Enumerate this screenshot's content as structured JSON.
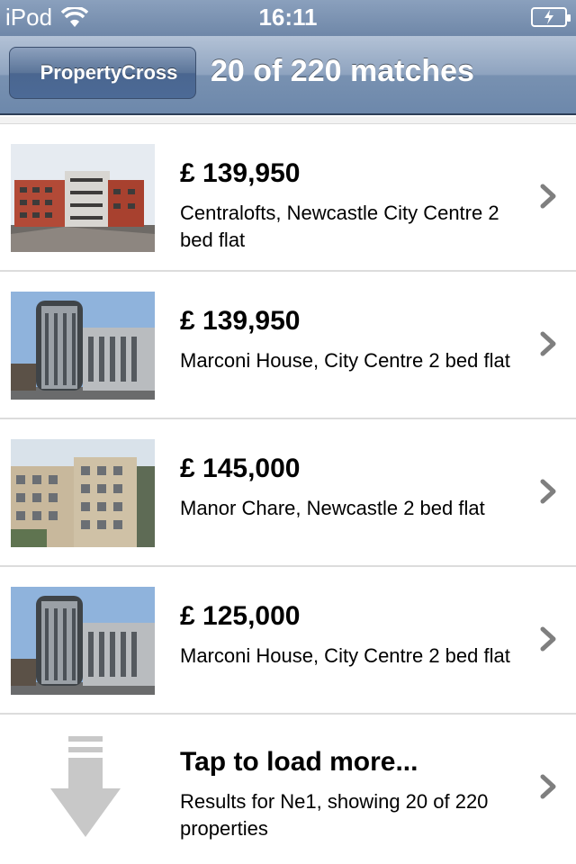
{
  "status_bar": {
    "carrier": "iPod",
    "time": "16:11"
  },
  "nav_bar": {
    "back_label": "PropertyCross",
    "title": "20 of 220 matches"
  },
  "listings": [
    {
      "price": "£ 139,950",
      "title": "Centralofts, Newcastle City Centre 2 bed flat",
      "thumb_icon": "building-photo-red"
    },
    {
      "price": "£ 139,950",
      "title": "Marconi House, City Centre 2 bed flat",
      "thumb_icon": "building-photo-grey"
    },
    {
      "price": "£ 145,000",
      "title": "Manor Chare, Newcastle 2 bed flat",
      "thumb_icon": "building-photo-beige"
    },
    {
      "price": "£ 125,000",
      "title": "Marconi House, City Centre 2 bed flat",
      "thumb_icon": "building-photo-grey"
    }
  ],
  "load_more": {
    "title": "Tap to load more...",
    "subtitle": "Results for Ne1, showing 20 of 220 properties",
    "icon": "down-arrow-icon"
  },
  "colors": {
    "nav_bar": "#7891b1",
    "back_button": "#4c6a96",
    "chevron": "#7f7f7f",
    "divider": "#dcdcdc"
  }
}
